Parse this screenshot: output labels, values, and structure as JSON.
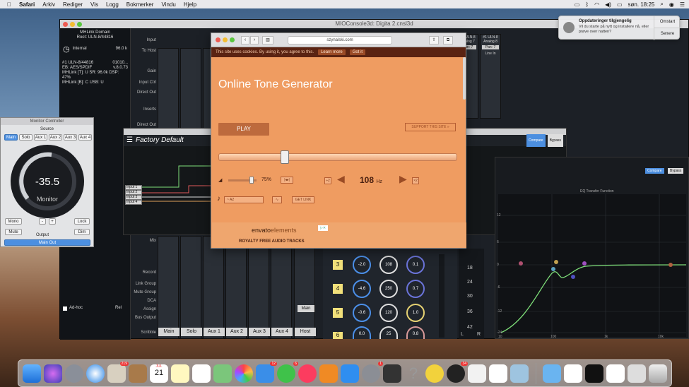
{
  "menubar": {
    "apple": "",
    "app": "Safari",
    "items": [
      "Arkiv",
      "Rediger",
      "Vis",
      "Logg",
      "Bokmerker",
      "Vindu",
      "Hjelp"
    ],
    "clock": "søn. 18:25"
  },
  "console": {
    "title": "MIOConsole3d: Digita 2.cnsl3d",
    "domain_title": "MHLink Domain",
    "root": "Root: ULN-8/44816",
    "clock_source": "Internal",
    "sample_rate": "96.0 k",
    "device_line1": "#1 ULN-8/44816",
    "device_val1": "01010...",
    "device_line2": "EB: AES/SPDIF",
    "device_val2": "v.8.0.73",
    "device_line3": "MHLink [T]: U SR: 96.0k DSP: 47%",
    "device_line4": "MHLink [B]: C USB: U",
    "row_labels": [
      "Input",
      "To Host",
      "Gain",
      "Input Ctrl",
      "Direct Out",
      "Inserts",
      "Direct Out",
      "Mix",
      "Record",
      "Link Group",
      "Mute Group",
      "DCA",
      "Assign",
      "Bus Output",
      "Scribble"
    ],
    "adhoc": "Ad-hoc",
    "rel": "Rel",
    "channels": [
      "Main",
      "Solo",
      "Aux 1",
      "Aux 2",
      "Aux 3",
      "Aux 4",
      "Host"
    ],
    "main_btn": "Main",
    "right_strip1": "#1 ULN-8",
    "right_strip1b": "Analog 7",
    "right_strip2": "#1 ULN-8",
    "right_strip2b": "Analog 8",
    "pan1": "Pan: 7",
    "pan2": "Pan: 7",
    "line_in": "Line In"
  },
  "monitor": {
    "title": "Monitor Controller",
    "source_label": "Source",
    "sources": [
      "Main",
      "Solo",
      "Aux 1",
      "Aux 2",
      "Aux 3",
      "Aux 4"
    ],
    "value": "-35.5",
    "label": "Monitor",
    "mono": "Mono",
    "mute": "Mute",
    "lock": "Lock",
    "dim": "Dim",
    "minus": "-",
    "plus": "+",
    "output_label": "Output",
    "output_value": "Main Out"
  },
  "factory": {
    "title_bar": "Factory Default",
    "name": "Factory Default",
    "compare": "Compare",
    "bypass": "Bypass",
    "inputs": [
      "Input 1",
      "Input 2",
      "Input 3",
      "Input 4"
    ],
    "outputs": [
      "Output 1",
      "Output 2",
      "Output 3",
      "Output 4"
    ]
  },
  "eq": {
    "compare": "Compare",
    "bypass": "Bypass",
    "title": "EQ Transfer Function",
    "ylabels": [
      "12",
      "6",
      "0",
      "-6",
      "-12",
      "-24"
    ],
    "xlabels": [
      "10",
      "100",
      "1k",
      "10k"
    ]
  },
  "dsp": {
    "bands": [
      "3",
      "4",
      "5",
      "6"
    ],
    "knob_rows": [
      [
        "-2.0",
        "108",
        "0.1"
      ],
      [
        "-4.6",
        "250",
        "0.7"
      ],
      [
        "-0.6",
        "120",
        "1.0"
      ],
      [
        "0.0",
        "25",
        "0.8"
      ]
    ],
    "meter_labels": [
      "18",
      "24",
      "30",
      "36",
      "42"
    ],
    "lr": [
      "L",
      "R"
    ]
  },
  "safari": {
    "url": "szynalski.com",
    "cookie_text": "This site uses cookies. By using it, you agree to this.",
    "learn_more": "Learn more",
    "got_it": "Got it",
    "title": "Online Tone Generator",
    "play": "PLAY",
    "support": "SUPPORT THIS SITE »",
    "volume": "75%",
    "freq_value": "108",
    "freq_unit": "Hz",
    "div2": "÷2",
    "x2": "×2",
    "note": "~ A2",
    "get_link": "GET LINK",
    "ad_brand": "envato",
    "ad_brand2": "elements",
    "ad_text": "ROYALTY FREE AUDIO TRACKS",
    "slider_fraction": 0.27
  },
  "notification": {
    "title": "Oppdateringer tilgjengelig",
    "body": "Vil du starte på nytt og installere nå, eller prøve over natten?",
    "action1": "Omstart",
    "action2": "Senere"
  },
  "desktop": {
    "folder_label": "macmusic-alias"
  },
  "dock": {
    "badge_photos": "219",
    "badge_calendar_month": "JUL",
    "badge_calendar_day": "21",
    "badge_mail": "12",
    "badge_msg": "6",
    "badge_settings": "1",
    "badge_pirate": "34"
  },
  "colors": {
    "safari_bg": "#ef9c61",
    "console_bg": "#1c2026",
    "accent_blue": "#4c8fe0",
    "eq_curve": "#7fe07a"
  }
}
